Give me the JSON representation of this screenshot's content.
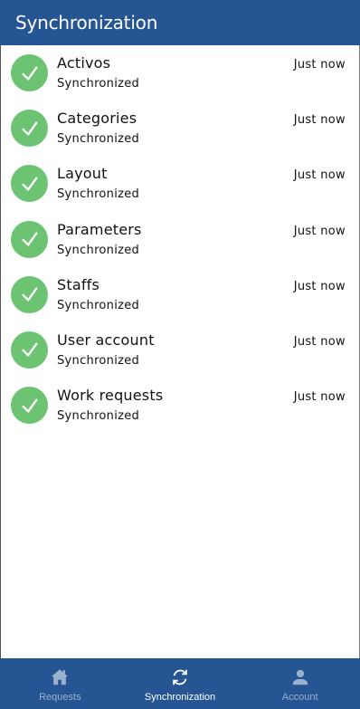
{
  "header": {
    "title": "Synchronization"
  },
  "sync_list": [
    {
      "name": "Activos",
      "status": "Synchronized",
      "time": "Just now",
      "icon": "check-icon"
    },
    {
      "name": "Categories",
      "status": "Synchronized",
      "time": "Just now",
      "icon": "check-icon"
    },
    {
      "name": "Layout",
      "status": "Synchronized",
      "time": "Just now",
      "icon": "check-icon"
    },
    {
      "name": "Parameters",
      "status": "Synchronized",
      "time": "Just now",
      "icon": "check-icon"
    },
    {
      "name": "Staffs",
      "status": "Synchronized",
      "time": "Just now",
      "icon": "check-icon"
    },
    {
      "name": "User account",
      "status": "Synchronized",
      "time": "Just now",
      "icon": "check-icon"
    },
    {
      "name": "Work requests",
      "status": "Synchronized",
      "time": "Just now",
      "icon": "check-icon"
    }
  ],
  "bottom_nav": {
    "items": [
      {
        "label": "Requests",
        "icon": "home-icon",
        "active": false
      },
      {
        "label": "Synchronization",
        "icon": "sync-icon",
        "active": true
      },
      {
        "label": "Account",
        "icon": "person-icon",
        "active": false
      }
    ]
  },
  "colors": {
    "primary": "#265593",
    "success": "#6cc472",
    "nav_inactive": "#9bb0cc",
    "nav_active": "#ffffff"
  }
}
